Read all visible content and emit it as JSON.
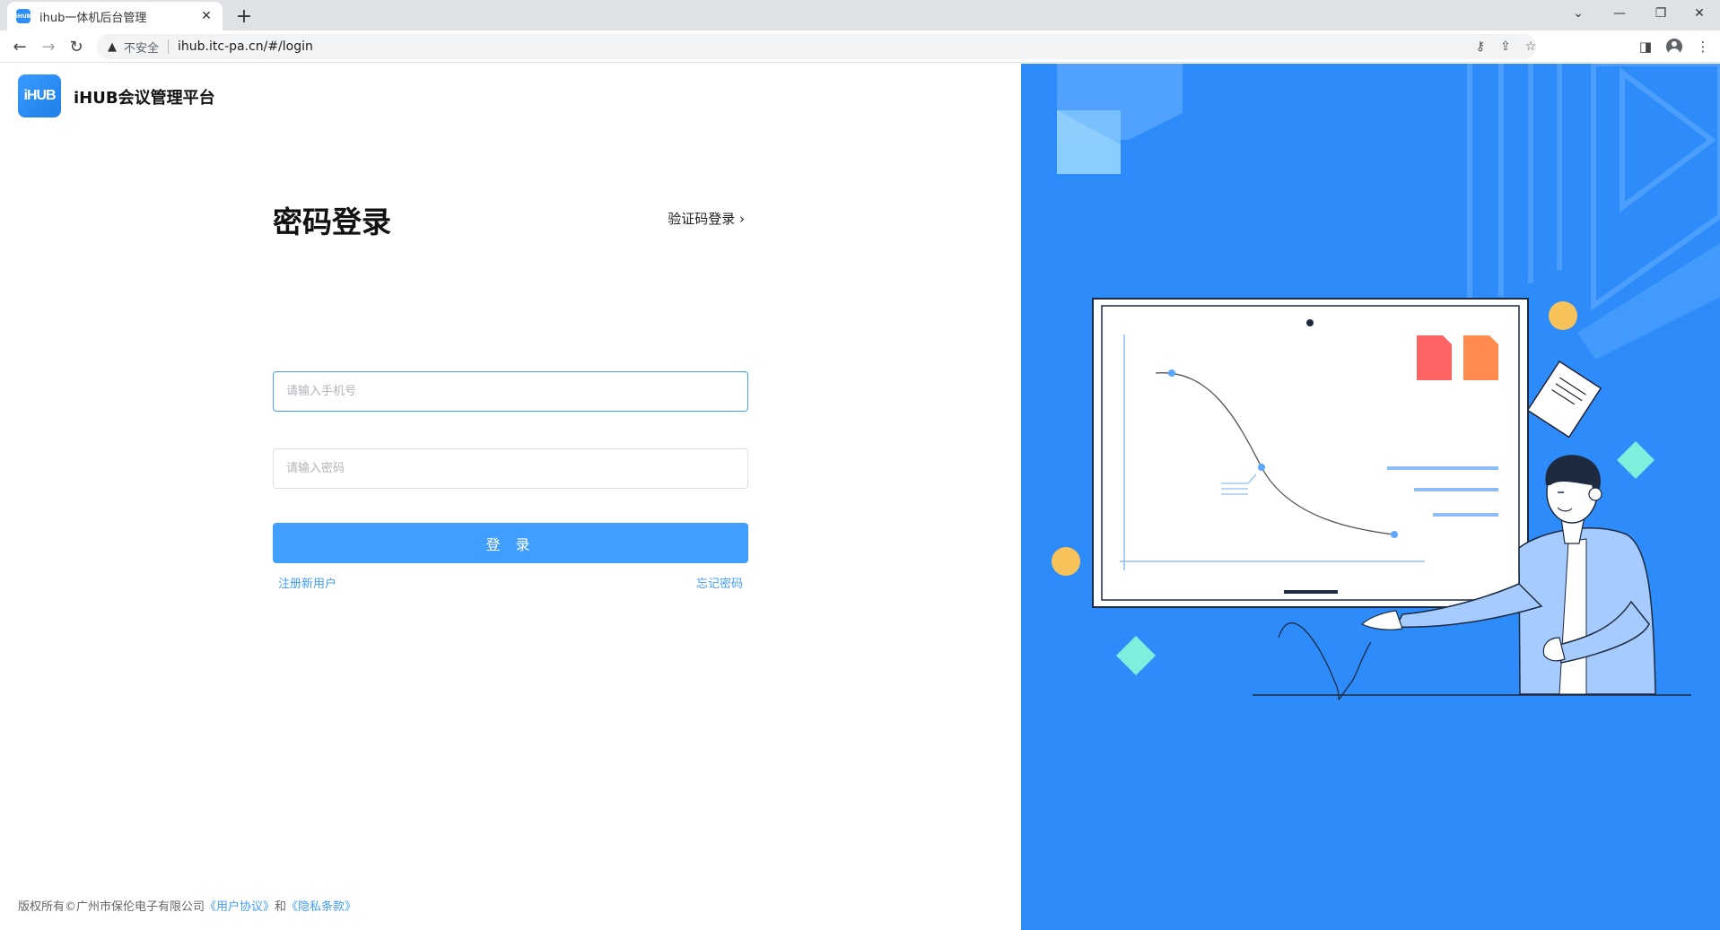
{
  "browser": {
    "tab_title": "ihub一体机后台管理",
    "tab_favicon_text": "iHUB",
    "not_secure_label": "不安全",
    "url": "ihub.itc-pa.cn/#/login"
  },
  "header": {
    "logo_text": "iHUB",
    "brand_name": "iHUB会议管理平台"
  },
  "login": {
    "title": "密码登录",
    "switch_link": "验证码登录",
    "phone_placeholder": "请输入手机号",
    "phone_value": "",
    "password_placeholder": "请输入密码",
    "password_value": "",
    "submit_label": "登 录",
    "register_link": "注册新用户",
    "forgot_link": "忘记密码"
  },
  "footer": {
    "copyright": "版权所有©广州市保伦电子有限公司",
    "user_agreement": "《用户协议》",
    "and": "和",
    "privacy": "《隐私条款》"
  },
  "colors": {
    "accent": "#409eff",
    "illustration_bg": "#2d8cfa"
  }
}
